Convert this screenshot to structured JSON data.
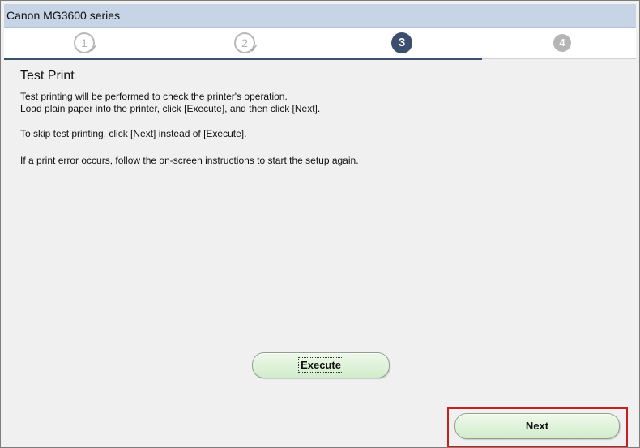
{
  "window": {
    "title": "Canon MG3600 series"
  },
  "steps": [
    {
      "label": "1",
      "state": "done"
    },
    {
      "label": "2",
      "state": "done"
    },
    {
      "label": "3",
      "state": "current"
    },
    {
      "label": "4",
      "state": "future"
    }
  ],
  "step_check_glyph": "✓",
  "content": {
    "heading": "Test Print",
    "line1": "Test printing will be performed to check the printer's operation.",
    "line2": "Load plain paper into the printer, click [Execute], and then click [Next].",
    "line3": "To skip test printing, click [Next] instead of [Execute].",
    "line4": "If a print error occurs, follow the on-screen instructions to start the setup again."
  },
  "buttons": {
    "execute_label": "Execute",
    "next_label": "Next"
  },
  "colors": {
    "accent": "#3d4f6e",
    "button_green": "#d2eccb",
    "highlight_red": "#c81e1e",
    "titlebar": "#c6d4e6"
  }
}
